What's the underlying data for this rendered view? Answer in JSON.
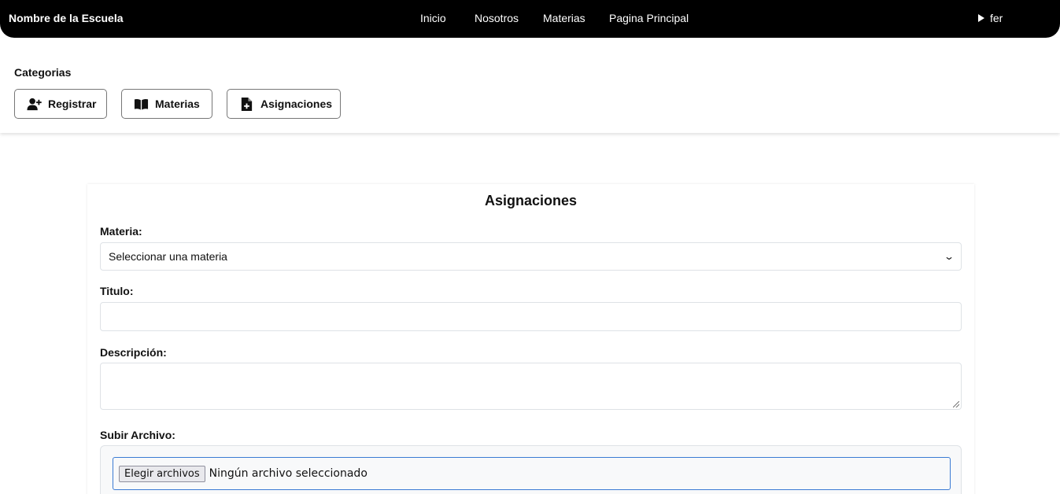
{
  "header": {
    "brand": "Nombre de la Escuela",
    "nav": [
      "Inicio",
      "Nosotros",
      "Materias",
      "Pagina Principal"
    ],
    "user": "fer"
  },
  "categories": {
    "title": "Categorias",
    "buttons": [
      {
        "label": "Registrar",
        "icon": "user-plus-icon"
      },
      {
        "label": "Materias",
        "icon": "book-icon"
      },
      {
        "label": "Asignaciones",
        "icon": "file-add-icon"
      }
    ]
  },
  "form": {
    "title": "Asignaciones",
    "materia_label": "Materia:",
    "materia_selected": "Seleccionar una materia",
    "titulo_label": "Titulo:",
    "titulo_value": "",
    "descripcion_label": "Descripción:",
    "descripcion_value": "",
    "archivo_label": "Subir Archivo:",
    "file_button": "Elegir archivos",
    "file_status": "Ningún archivo seleccionado"
  }
}
